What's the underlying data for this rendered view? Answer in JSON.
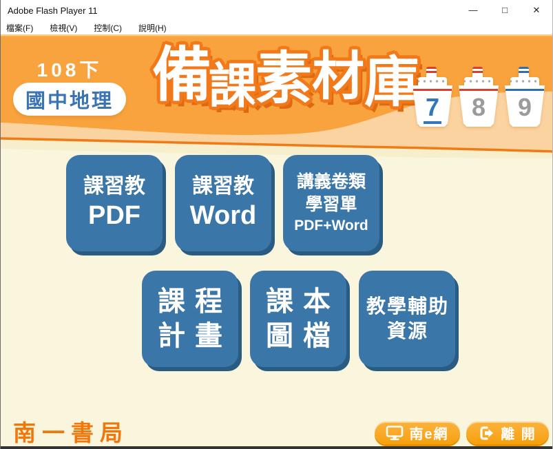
{
  "window": {
    "title": "Adobe Flash Player 11",
    "controls": [
      {
        "id": "minimize",
        "glyph": "—"
      },
      {
        "id": "maximize",
        "glyph": "□"
      },
      {
        "id": "close",
        "glyph": "✕"
      }
    ]
  },
  "menu": {
    "items": [
      {
        "id": "file",
        "label": "檔案(F)"
      },
      {
        "id": "view",
        "label": "檢視(V)"
      },
      {
        "id": "control",
        "label": "控制(C)"
      },
      {
        "id": "help",
        "label": "說明(H)"
      }
    ]
  },
  "header": {
    "semester": "108下",
    "subject": "國中地理",
    "app_title": "備課素材庫",
    "grade_tabs": [
      {
        "number": "7",
        "active": true,
        "stripe_color": "#E03B2B"
      },
      {
        "number": "8",
        "active": false,
        "stripe_color": "#E03B2B"
      },
      {
        "number": "9",
        "active": false,
        "stripe_color": "#2E6DB4"
      }
    ]
  },
  "materials": {
    "buttons": [
      {
        "id": "kexijiao-pdf",
        "lines": [
          "課習教",
          "PDF"
        ]
      },
      {
        "id": "kexijiao-word",
        "lines": [
          "課習教",
          "Word"
        ]
      },
      {
        "id": "worksheets",
        "lines": [
          "講義卷類",
          "學習單",
          "PDF+Word"
        ]
      },
      {
        "id": "curriculum-plan",
        "lines": [
          "課程",
          "計畫"
        ]
      },
      {
        "id": "textbook-images",
        "lines": [
          "課本",
          "圖檔"
        ]
      },
      {
        "id": "teaching-resources",
        "lines": [
          "教學輔助",
          "資源"
        ]
      }
    ]
  },
  "footer": {
    "publisher": "南一書局",
    "nan_e_label": "南e網",
    "exit_label": "離 開"
  },
  "colors": {
    "header_orange": "#F8A33E",
    "wave_peach": "#FBD3A0",
    "wave_line": "#EE7B16",
    "background_cream": "#FAF6DE",
    "title_outline": "#F2791A",
    "button_blue": "#3B76A8",
    "button_shadow": "#2A5B80",
    "subject_blue": "#3B74B4",
    "publisher_orange": "#F2770B",
    "cta_orange": "#F7A612",
    "grade_active_blue": "#3377B8",
    "grade_inactive_gray": "#9B9B9B",
    "stripe_red": "#E03B2B",
    "stripe_blue": "#2E6DB4"
  }
}
